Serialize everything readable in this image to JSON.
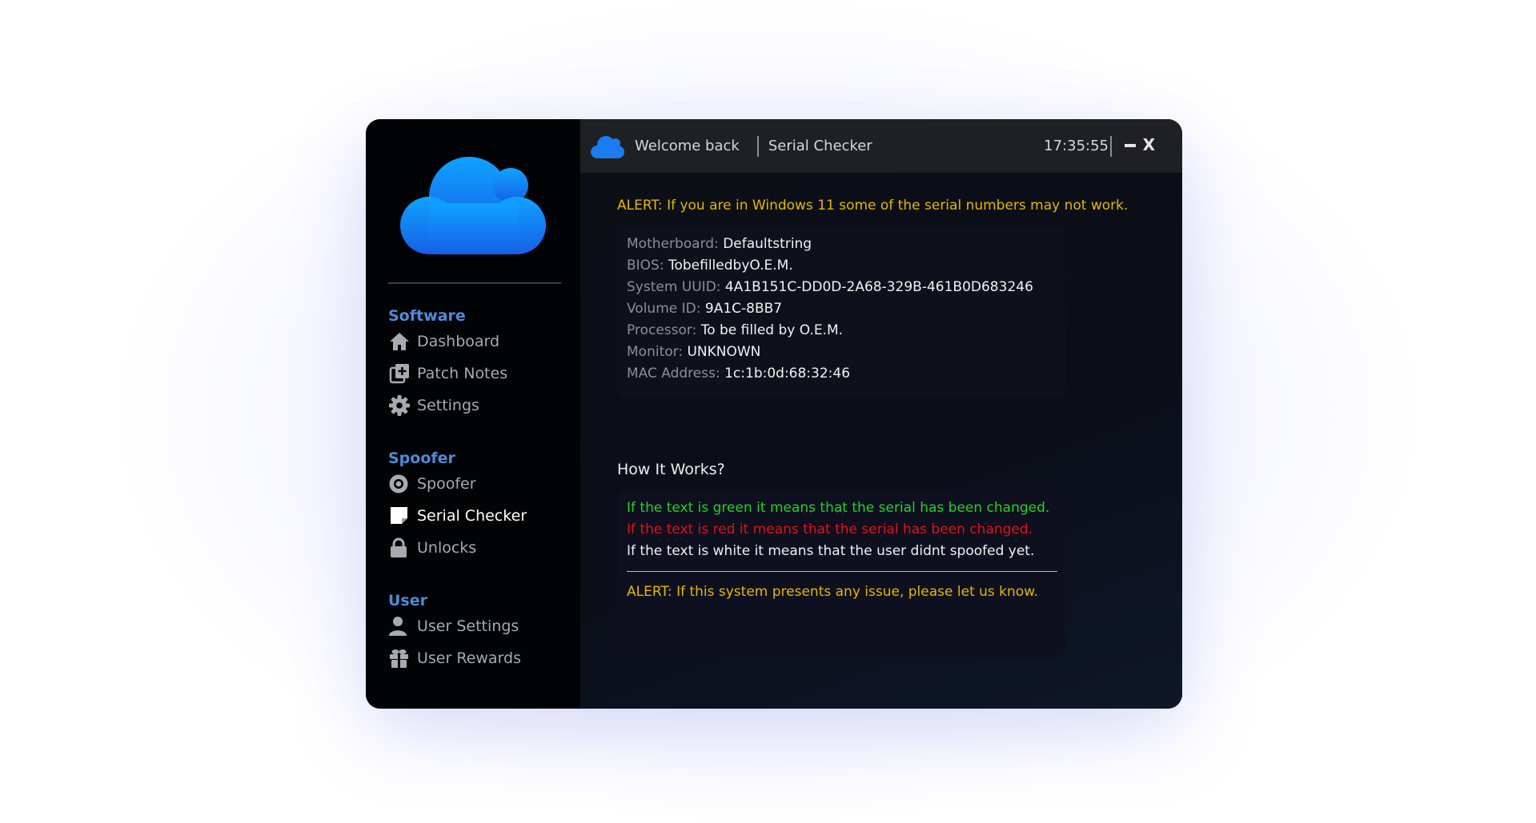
{
  "topbar": {
    "welcome": "Welcome back",
    "page": "Serial Checker",
    "time": "17:35:55",
    "minimize_label": "−",
    "close_label": "X"
  },
  "sidebar": {
    "sections": [
      {
        "header": "Software",
        "items": [
          {
            "label": "Dashboard",
            "icon": "home-icon"
          },
          {
            "label": "Patch Notes",
            "icon": "patch-notes-icon"
          },
          {
            "label": "Settings",
            "icon": "gear-icon"
          }
        ]
      },
      {
        "header": "Spoofer",
        "items": [
          {
            "label": "Spoofer",
            "icon": "spoofer-icon"
          },
          {
            "label": "Serial Checker",
            "icon": "note-icon",
            "active": true
          },
          {
            "label": "Unlocks",
            "icon": "lock-icon"
          }
        ]
      },
      {
        "header": "User",
        "items": [
          {
            "label": "User Settings",
            "icon": "user-icon"
          },
          {
            "label": "User Rewards",
            "icon": "gift-icon"
          }
        ]
      }
    ]
  },
  "main": {
    "alert_top": "ALERT: If you are in Windows 11 some of the serial numbers may not work.",
    "info": [
      {
        "label": "Motherboard:",
        "value": "Defaultstring"
      },
      {
        "label": "BIOS:",
        "value": "TobefilledbyO.E.M."
      },
      {
        "label": "System UUID:",
        "value": "4A1B151C-DD0D-2A68-329B-461B0D683246"
      },
      {
        "label": "Volume ID:",
        "value": "9A1C-8BB7"
      },
      {
        "label": "Processor:",
        "value": "To be filled by O.E.M."
      },
      {
        "label": "Monitor:",
        "value": "UNKNOWN"
      },
      {
        "label": "MAC Address:",
        "value": "1c:1b:0d:68:32:46"
      }
    ],
    "how_title": "How It Works?",
    "how": {
      "green": "If the text is green it means that the serial has been changed.",
      "red": "If the text is red it means that the serial has been changed.",
      "white": "If the text is white it means that the user didnt spoofed yet.",
      "alert": "ALERT: If this system presents any issue, please let us know."
    }
  },
  "colors": {
    "accent": "#4f8ad8",
    "cloud": "#1a7cf0",
    "alert": "#e6b800",
    "green": "#1fd61f",
    "red": "#e4121a"
  }
}
